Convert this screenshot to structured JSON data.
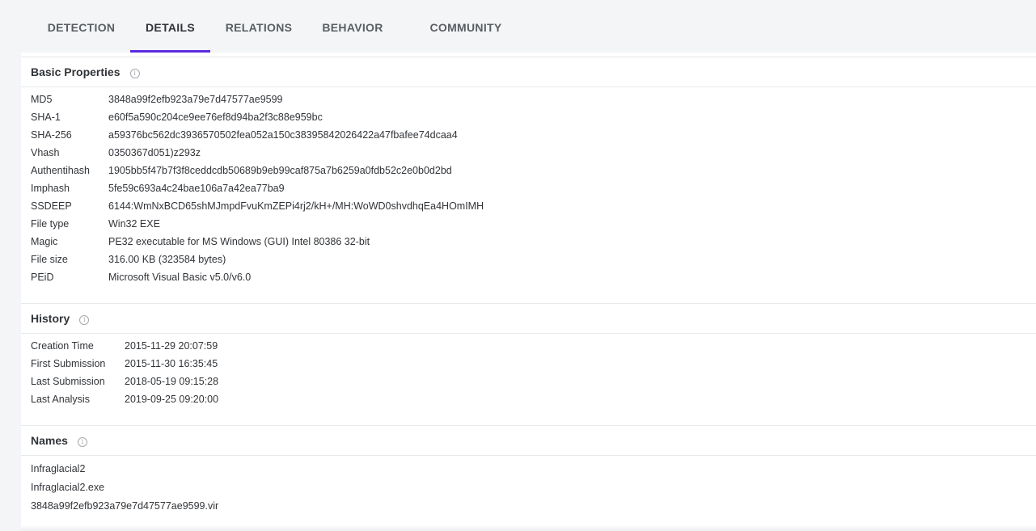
{
  "tabs": [
    {
      "label": "DETECTION"
    },
    {
      "label": "DETAILS"
    },
    {
      "label": "RELATIONS"
    },
    {
      "label": "BEHAVIOR"
    },
    {
      "label": "COMMUNITY"
    }
  ],
  "active_tab": "DETAILS",
  "accent_color": "#5b2be0",
  "basic": {
    "title": "Basic Properties",
    "info_icon": "info-circle-icon",
    "rows": [
      {
        "key": "MD5",
        "value": "3848a99f2efb923a79e7d47577ae9599"
      },
      {
        "key": "SHA-1",
        "value": "e60f5a590c204ce9ee76ef8d94ba2f3c88e959bc"
      },
      {
        "key": "SHA-256",
        "value": "a59376bc562dc3936570502fea052a150c38395842026422a47fbafee74dcaa4"
      },
      {
        "key": "Vhash",
        "value": "0350367d051)z293z"
      },
      {
        "key": "Authentihash",
        "value": "1905bb5f47b7f3f8ceddcdb50689b9eb99caf875a7b6259a0fdb52c2e0b0d2bd"
      },
      {
        "key": "Imphash",
        "value": "5fe59c693a4c24bae106a7a42ea77ba9"
      },
      {
        "key": "SSDEEP",
        "value": "6144:WmNxBCD65shMJmpdFvuKmZEPi4rj2/kH+/MH:WoWD0shvdhqEa4HOmIMH"
      },
      {
        "key": "File type",
        "value": "Win32 EXE"
      },
      {
        "key": "Magic",
        "value": "PE32 executable for MS Windows (GUI) Intel 80386 32-bit"
      },
      {
        "key": "File size",
        "value": "316.00 KB (323584 bytes)"
      },
      {
        "key": "PEiD",
        "value": "Microsoft Visual Basic v5.0/v6.0"
      }
    ]
  },
  "history": {
    "title": "History",
    "rows": [
      {
        "key": "Creation Time",
        "value": "2015-11-29 20:07:59"
      },
      {
        "key": "First Submission",
        "value": "2015-11-30 16:35:45"
      },
      {
        "key": "Last Submission",
        "value": "2018-05-19 09:15:28"
      },
      {
        "key": "Last Analysis",
        "value": "2019-09-25 09:20:00"
      }
    ]
  },
  "names": {
    "title": "Names",
    "items": [
      "Infraglacial2",
      "Infraglacial2.exe",
      "3848a99f2efb923a79e7d47577ae9599.vir"
    ]
  }
}
